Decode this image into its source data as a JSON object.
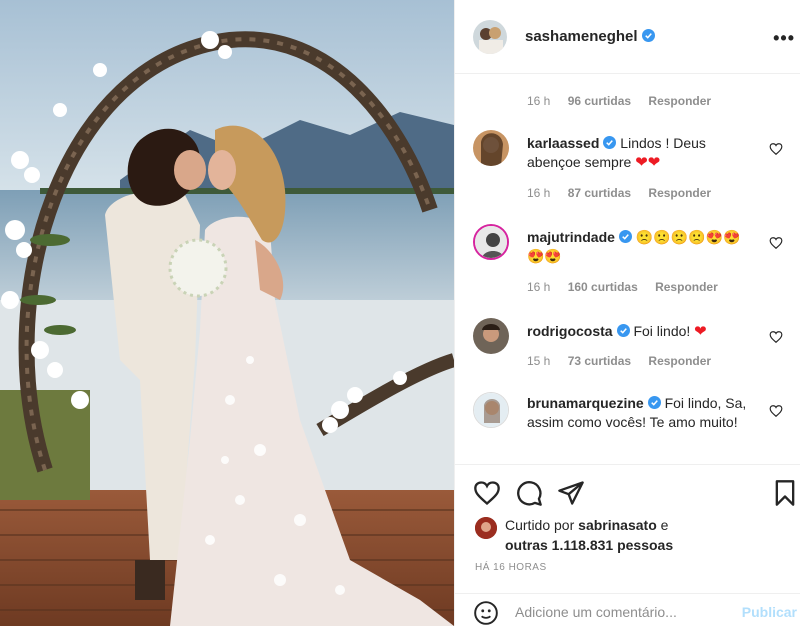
{
  "post": {
    "author": "sashameneghel",
    "more_icon": "more-horizontal-icon"
  },
  "first_meta": {
    "time": "16 h",
    "likes": "96 curtidas",
    "reply": "Responder"
  },
  "comments": [
    {
      "user": "karlaassed",
      "text": "Lindos ! Deus abençoe sempre",
      "suffix": "❤❤",
      "time": "16 h",
      "likes": "87 curtidas",
      "reply": "Responder"
    },
    {
      "user": "majutrindade",
      "text": "",
      "suffix": "🙁🙁🙁🙁😍😍😍😍",
      "time": "16 h",
      "likes": "160 curtidas",
      "reply": "Responder"
    },
    {
      "user": "rodrigocosta",
      "text": "Foi lindo!",
      "suffix": "❤",
      "time": "15 h",
      "likes": "73 curtidas",
      "reply": "Responder"
    },
    {
      "user": "brunamarquezine",
      "text": "Foi lindo, Sa, assim como vocês! Te amo muito!",
      "suffix": "",
      "time": "",
      "likes": "",
      "reply": ""
    }
  ],
  "actions": {
    "liked_prefix": "Curtido por",
    "liked_user": "sabrinasato",
    "liked_join": "e",
    "liked_others": "outras 1.118.831 pessoas",
    "timestamp": "HÁ 16 HORAS"
  },
  "add_comment": {
    "placeholder": "Adicione um comentário...",
    "publish": "Publicar"
  },
  "colors": {
    "verified": "#3897f0",
    "heart": "#ed1b24",
    "publish": "#b2dffc"
  }
}
